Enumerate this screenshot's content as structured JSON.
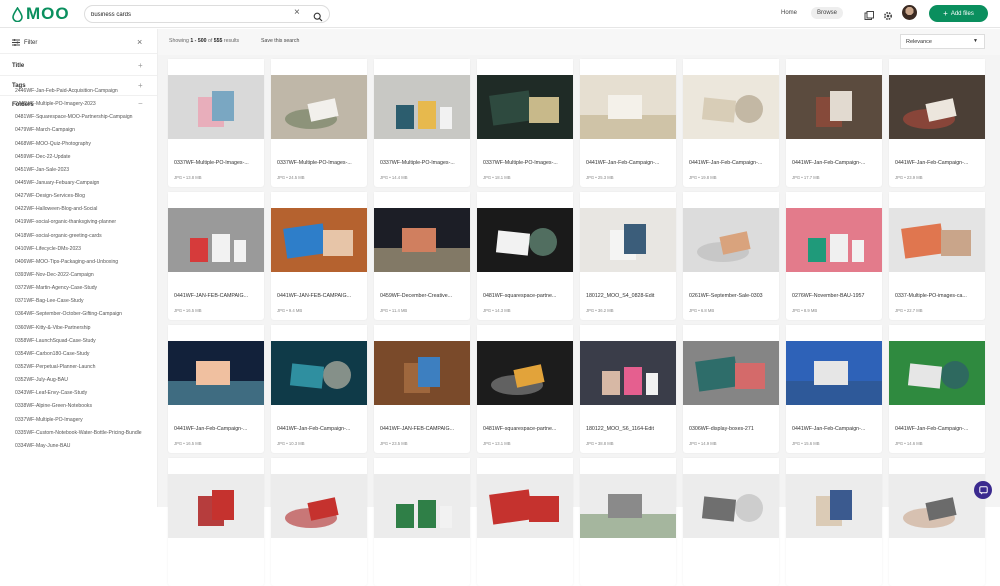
{
  "header": {
    "logo_text": "MOO",
    "search_value": "business cards",
    "nav_home": "Home",
    "nav_browse": "Browse",
    "add_files": "Add files",
    "brand_color": "#0a8f5e"
  },
  "sidebar": {
    "filter_label": "Filter",
    "sections": [
      "Title",
      "Tags",
      "Folders"
    ],
    "folders": [
      "2446WF-Jan-Feb-Paid-Acquisition-Campaign",
      "2446WF-Multiple-PO-Imagery-2023",
      "0481WF-Squarespace-MOO-Partnership-Campaign",
      "0479WF-March-Campaign",
      "0468WF-MOO-Quiz-Photography",
      "0459WF-Dec-22-Update",
      "0451WF-Jan-Sale-2023",
      "0445WF-January-Febuary-Campaign",
      "0427WF-Design-Services-Blog",
      "0422WF-Halloween-Blog-and-Social",
      "0419WF-social-organic-thanksgiving-planner",
      "0418WF-social-organic-greeting-cards",
      "0410WF-Lifecycle-DMs-2023",
      "0406WF-MOO-Tips-Packaging-and-Unboxing",
      "0393WF-Nov-Dec-2022-Campaign",
      "0372WF-Martin-Agency-Case-Study",
      "0371WF-Bag-Lee-Case-Study",
      "0364WF-September-October-Gifting-Campaign",
      "0360WF-Kitty-&-Vibe-Partnership",
      "0358WF-LaunchSquad-Case-Study",
      "0354WF-Carbon180-Case-Study",
      "0352WF-Perpetual-Planner-Launch",
      "0352WF-July-Aug-BAU",
      "0343WF-Leaf-Envy-Case-Study",
      "0338WF-Alpine-Green-Notebooks",
      "0337WF-Multiple-PO-Imagery",
      "0335WF-Custom-Notebook-Water-Bottle-Pricing-Bundle",
      "0334WF-May-June-BAU"
    ]
  },
  "toolbar": {
    "showing_prefix": "Showing",
    "showing_range": "1 - 500",
    "showing_of": "of",
    "showing_total": "555",
    "showing_suffix": "results",
    "save_search": "Save this search",
    "sort_value": "Relevance"
  },
  "cards": [
    {
      "name": "0337WF-Multiple-PO-Images-...",
      "meta": "JPG  •  13.8 MB"
    },
    {
      "name": "0337WF-Multiple-PO-Images-...",
      "meta": "JPG  •  24.5 MB"
    },
    {
      "name": "0337WF-Multiple-PO-Images-...",
      "meta": "JPG  •  14.4 MB"
    },
    {
      "name": "0337WF-Multiple-PO-Images-...",
      "meta": "JPG  •  18.1 MB"
    },
    {
      "name": "0441WF-Jan-Feb-Campaign-...",
      "meta": "JPG  •  25.3 MB"
    },
    {
      "name": "0441WF-Jan-Feb-Campaign-...",
      "meta": "JPG  •  19.8 MB"
    },
    {
      "name": "0441WF-Jan-Feb-Campaign-...",
      "meta": "JPG  •  17.7 MB"
    },
    {
      "name": "0441WF-Jan-Feb-Campaign-...",
      "meta": "JPG  •  23.9 MB"
    },
    {
      "name": "0441WF-JAN-FEB-CAMPAIG...",
      "meta": "JPG  •  16.5 MB"
    },
    {
      "name": "0441WF-JAN-FEB-CAMPAIG...",
      "meta": "JPG  •  9.4 MB"
    },
    {
      "name": "0459WF-December-Creative...",
      "meta": "JPG  •  11.4 MB"
    },
    {
      "name": "0481WF-squarespace-partne...",
      "meta": "JPG  •  14.3 MB"
    },
    {
      "name": "180122_MOO_S4_0828-Edit",
      "meta": "JPG  •  36.2 MB"
    },
    {
      "name": "0261WF-September-Sale-0303",
      "meta": "JPG  •  6.8 MB"
    },
    {
      "name": "0276WF-November-BAU-1957",
      "meta": "JPG  •  8.9 MB"
    },
    {
      "name": "0337-Multiple-PO-images-ca...",
      "meta": "JPG  •  22.7 MB"
    },
    {
      "name": "0441WF-Jan-Feb-Campaign-...",
      "meta": "JPG  •  16.5 MB"
    },
    {
      "name": "0441WF-Jan-Feb-Campaign-...",
      "meta": "JPG  •  10.3 MB"
    },
    {
      "name": "0441WF-JAN-FEB-CAMPAIG...",
      "meta": "JPG  •  23.5 MB"
    },
    {
      "name": "0481WF-squarespace-partne...",
      "meta": "JPG  •  13.1 MB"
    },
    {
      "name": "180122_MOO_S6_1164-Edit",
      "meta": "JPG  •  38.8 MB"
    },
    {
      "name": "0306WF-display-boxes-271",
      "meta": "JPG  •  14.9 MB"
    },
    {
      "name": "0441WF-Jan-Feb-Campaign-...",
      "meta": "JPG  •  15.6 MB"
    },
    {
      "name": "0441WF-Jan-Feb-Campaign-...",
      "meta": "JPG  •  14.6 MB"
    },
    {
      "name": "",
      "meta": ""
    },
    {
      "name": "",
      "meta": ""
    },
    {
      "name": "",
      "meta": ""
    },
    {
      "name": "",
      "meta": ""
    },
    {
      "name": "",
      "meta": ""
    },
    {
      "name": "",
      "meta": ""
    },
    {
      "name": "",
      "meta": ""
    },
    {
      "name": "",
      "meta": ""
    }
  ],
  "thumb_scenes": [
    {
      "bg": "#d9d9d9",
      "fg": "#7aa7c2",
      "acc": "#e9a8b7"
    },
    {
      "bg": "#bfb7a8",
      "fg": "#f2f0ec",
      "acc": "#6c7c5c"
    },
    {
      "bg": "#c8c8c4",
      "fg": "#2c5d6e",
      "acc": "#e7b94d"
    },
    {
      "bg": "#1f2b26",
      "fg": "#2e4a3f",
      "acc": "#c8b98a"
    },
    {
      "bg": "#e6dfd1",
      "fg": "#f4f1ea",
      "acc": "#b8a77e"
    },
    {
      "bg": "#ece7dc",
      "fg": "#d8cdb7",
      "acc": "#a39276"
    },
    {
      "bg": "#5b4b3e",
      "fg": "#e2dad0",
      "acc": "#8b4a3a"
    },
    {
      "bg": "#4b3f36",
      "fg": "#ece6dd",
      "acc": "#b04a3c"
    },
    {
      "bg": "#9a9a9a",
      "fg": "#d63b3b",
      "acc": "#f2f2f2"
    },
    {
      "bg": "#b5622f",
      "fg": "#2e7ec9",
      "acc": "#e7c5a8"
    },
    {
      "bg": "#1c1e26",
      "fg": "#d07f5f",
      "acc": "#e7d3a6"
    },
    {
      "bg": "#1a1a1a",
      "fg": "#f2f2f2",
      "acc": "#7fb59a"
    },
    {
      "bg": "#e8e6e2",
      "fg": "#3b5d7a",
      "acc": "#f5f5f5"
    },
    {
      "bg": "#dcdcdc",
      "fg": "#d9a37d",
      "acc": "#b9b9b9"
    },
    {
      "bg": "#e37b8b",
      "fg": "#1f9a7a",
      "acc": "#f0f0f0"
    },
    {
      "bg": "#e4e4e4",
      "fg": "#e0764f",
      "acc": "#c9a58a"
    },
    {
      "bg": "#12213a",
      "fg": "#f0c0a0",
      "acc": "#6bb7c8"
    },
    {
      "bg": "#0f3a48",
      "fg": "#2f8fa0",
      "acc": "#e8d7bf"
    },
    {
      "bg": "#7a4a2a",
      "fg": "#3d7fc0",
      "acc": "#a36a3f"
    },
    {
      "bg": "#1c1c1c",
      "fg": "#e2a33a",
      "acc": "#8f8f8f"
    },
    {
      "bg": "#3a3d49",
      "fg": "#d7b8a5",
      "acc": "#e55f8f"
    },
    {
      "bg": "#858585",
      "fg": "#2e6d6a",
      "acc": "#d46a6a"
    },
    {
      "bg": "#2e62b8",
      "fg": "#e6e6e6",
      "acc": "#2d4f7a"
    },
    {
      "bg": "#2f8a3f",
      "fg": "#e6e6e6",
      "acc": "#2d4f7a"
    },
    {
      "bg": "#ececec",
      "fg": "#c5322e",
      "acc": "#b02a2a"
    },
    {
      "bg": "#ececec",
      "fg": "#c5322e",
      "acc": "#b02a2a"
    },
    {
      "bg": "#ececec",
      "fg": "#2f7f47",
      "acc": "#2f7f47"
    },
    {
      "bg": "#ececec",
      "fg": "#c5322e",
      "acc": "#c5322e"
    },
    {
      "bg": "#ececec",
      "fg": "#8a8a8a",
      "acc": "#5e7f4f"
    },
    {
      "bg": "#ececec",
      "fg": "#6f6f6f",
      "acc": "#b5b5b5"
    },
    {
      "bg": "#ececec",
      "fg": "#3b5a8f",
      "acc": "#d9c8b0"
    },
    {
      "bg": "#ececec",
      "fg": "#6b6b6b",
      "acc": "#c9a58a"
    }
  ],
  "chat_color": "#3b2a8f"
}
